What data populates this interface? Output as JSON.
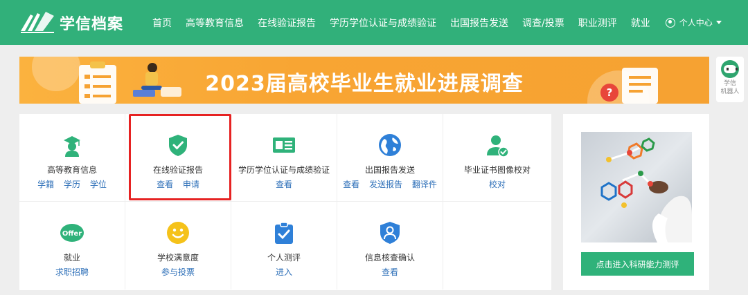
{
  "header": {
    "logo_text": "学信档案",
    "nav": [
      "首页",
      "高等教育信息",
      "在线验证报告",
      "学历学位认证与成绩验证",
      "出国报告发送",
      "调查/投票",
      "职业测评",
      "就业"
    ],
    "user_menu": "个人中心"
  },
  "banner": {
    "title": "2023届高校毕业生就业进展调查"
  },
  "robot": {
    "line1": "学信",
    "line2": "机器人"
  },
  "services": [
    {
      "title": "高等教育信息",
      "links": [
        "学籍",
        "学历",
        "学位"
      ],
      "icon": "graduate-icon"
    },
    {
      "title": "在线验证报告",
      "links": [
        "查看",
        "申请"
      ],
      "icon": "shield-check-icon"
    },
    {
      "title": "学历学位认证与成绩验证",
      "links": [
        "查看"
      ],
      "icon": "id-card-icon"
    },
    {
      "title": "出国报告发送",
      "links": [
        "查看",
        "发送报告",
        "翻译件"
      ],
      "icon": "globe-icon"
    },
    {
      "title": "毕业证书图像校对",
      "links": [
        "校对"
      ],
      "icon": "user-check-icon"
    },
    {
      "title": "就业",
      "links": [
        "求职招聘"
      ],
      "icon": "offer-icon",
      "badge": "Offer"
    },
    {
      "title": "学校满意度",
      "links": [
        "参与投票"
      ],
      "icon": "smiley-icon"
    },
    {
      "title": "个人测评",
      "links": [
        "进入"
      ],
      "icon": "clipboard-check-icon"
    },
    {
      "title": "信息核查确认",
      "links": [
        "查看"
      ],
      "icon": "user-shield-icon"
    }
  ],
  "side": {
    "button": "点击进入科研能力测评"
  },
  "colors": {
    "brand": "#31b07a",
    "link": "#2d6fb8",
    "highlight": "#e62222",
    "banner": "#f8a533"
  }
}
